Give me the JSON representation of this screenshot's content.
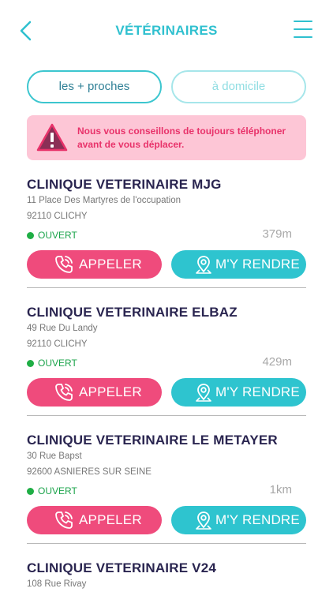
{
  "header": {
    "title": "VÉTÉRINAIRES"
  },
  "filters": {
    "nearest": "les + proches",
    "home": "à domicile"
  },
  "warning": {
    "text": "Nous vous conseillons de toujours téléphoner avant de vous déplacer."
  },
  "buttons": {
    "call": "APPELER",
    "go": "M'Y RENDRE"
  },
  "colors": {
    "accent": "#2fc0cf",
    "pink": "#ef4b7c",
    "open": "#1fae45",
    "warning_bg": "#fdc6d6"
  },
  "icons": {
    "back": "chevron-left-icon",
    "menu": "hamburger-menu-icon",
    "warning": "warning-triangle-icon",
    "call": "phone-icon",
    "go": "map-pin-icon"
  },
  "clinics": [
    {
      "name": "CLINIQUE VETERINAIRE MJG",
      "address1": "11 Place Des Martyres de l'occupation",
      "address2": "92110 CLICHY",
      "status": "OUVERT",
      "distance": "379m"
    },
    {
      "name": "CLINIQUE VETERINAIRE ELBAZ",
      "address1": "49 Rue Du Landy",
      "address2": "92110 CLICHY",
      "status": "OUVERT",
      "distance": "429m"
    },
    {
      "name": "CLINIQUE VETERINAIRE LE METAYER",
      "address1": "30 Rue Bapst",
      "address2": "92600 ASNIERES SUR SEINE",
      "status": "OUVERT",
      "distance": "1km"
    },
    {
      "name": "CLINIQUE VETERINAIRE V24",
      "address1": "108 Rue Rivay"
    }
  ]
}
